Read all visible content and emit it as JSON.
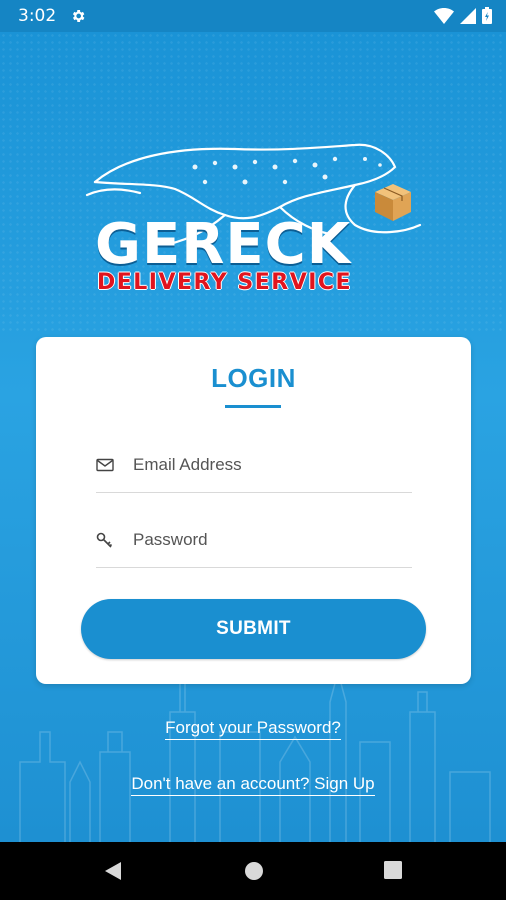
{
  "status_bar": {
    "time": "3:02",
    "icons": [
      "gear-icon",
      "wifi-icon",
      "signal-icon",
      "battery-icon"
    ]
  },
  "logo": {
    "title": "GERECK",
    "subtitle": "DELIVERY SERVICE"
  },
  "login": {
    "title": "LOGIN",
    "email_placeholder": "Email Address",
    "password_placeholder": "Password",
    "submit_label": "SUBMIT"
  },
  "links": {
    "forgot": "Forgot your Password?",
    "signup": "Don't have an account? Sign Up"
  },
  "colors": {
    "primary": "#1a8fd0",
    "background": "#2aa3e2",
    "accent_red": "#e0141e"
  }
}
